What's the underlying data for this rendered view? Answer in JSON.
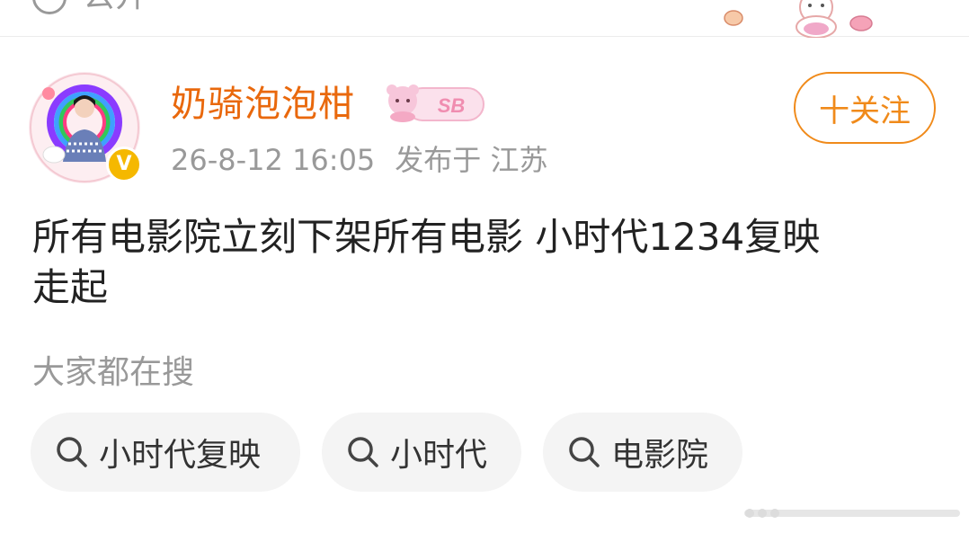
{
  "topbar": {
    "partial_text": "公开",
    "icon": "globe-icon"
  },
  "post": {
    "username": "奶骑泡泡柑",
    "badge_text": "SB",
    "verified_badge": "V",
    "timestamp": "26-8-12 16:05",
    "location": "发布于 江苏",
    "follow_label": "十关注",
    "text_line1": "所有电影院立刻下架所有电影 小时代1234复映",
    "text_line2": "走起"
  },
  "search": {
    "label": "大家都在搜",
    "chips": [
      "小时代复映",
      "小时代",
      "电影院"
    ]
  },
  "colors": {
    "accent": "#f08a1a",
    "username": "#e9680c",
    "muted": "#999999",
    "chip_bg": "#f4f4f4"
  }
}
